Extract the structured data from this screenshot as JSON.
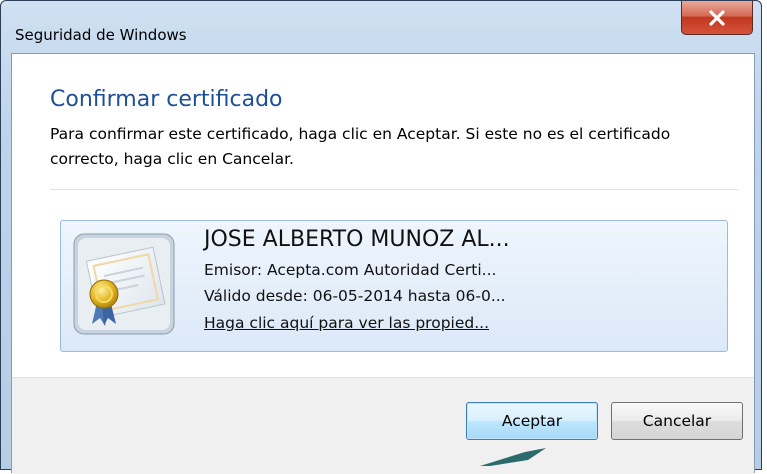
{
  "window": {
    "title": "Seguridad de Windows",
    "close_symbol": "X"
  },
  "dialog": {
    "heading": "Confirmar certificado",
    "description": "Para confirmar este certificado, haga clic en Aceptar. Si este no es el certificado correcto, haga clic en Cancelar."
  },
  "certificate": {
    "icon": "certificate-icon",
    "name": "JOSE ALBERTO MUNOZ AL...",
    "issuer": "Emisor: Acepta.com Autoridad Certi...",
    "validity": "Válido desde: 06-05-2014 hasta 06-0...",
    "properties_link": "Haga clic aquí para ver las propied..."
  },
  "buttons": {
    "ok_label": "Aceptar",
    "cancel_label": "Cancelar"
  },
  "colors": {
    "heading": "#1e4f96",
    "close_button": "#c0381f",
    "tile_border": "#9ebbdf",
    "annotation_arrow": "#2b6b6b"
  }
}
